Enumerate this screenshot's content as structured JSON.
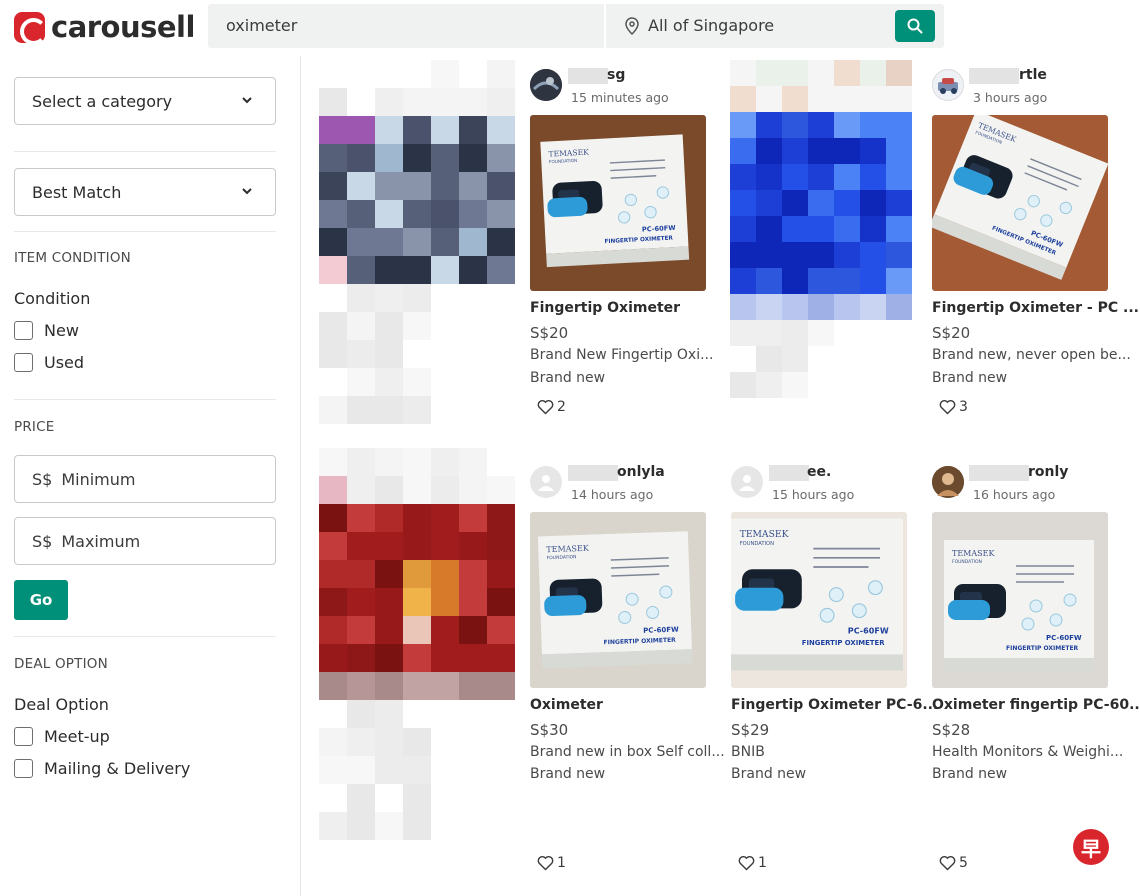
{
  "header": {
    "brand": "carousell",
    "search_query": "oximeter",
    "location": "All of Singapore"
  },
  "sidebar": {
    "category_select": "Select a category",
    "sort_select": "Best Match",
    "item_condition_header": "ITEM CONDITION",
    "condition_label": "Condition",
    "conditions": [
      "New",
      "Used"
    ],
    "price_header": "PRICE",
    "price_min": {
      "currency": "S$",
      "placeholder": "Minimum"
    },
    "price_max": {
      "currency": "S$",
      "placeholder": "Maximum"
    },
    "go_label": "Go",
    "deal_header": "DEAL OPTION",
    "deal_label": "Deal Option",
    "deals": [
      "Meet-up",
      "Mailing & Delivery"
    ]
  },
  "listings": [
    {
      "seller": "sg",
      "posted": "15 minutes ago",
      "title": "Fingertip Oximeter",
      "price": "S$20",
      "desc": "Brand New Fingertip Oxi...",
      "condition": "Brand new",
      "likes": "2"
    },
    {
      "seller": "rtle",
      "posted": "3 hours ago",
      "title": "Fingertip Oximeter - PC ...",
      "price": "S$20",
      "desc": "Brand new, never open be...",
      "condition": "Brand new",
      "likes": "3"
    },
    {
      "seller": "onlyla",
      "posted": "14 hours ago",
      "title": "Oximeter",
      "price": "S$30",
      "desc": "Brand new in box Self coll...",
      "condition": "Brand new",
      "likes": "1"
    },
    {
      "seller": "ee.",
      "posted": "15 hours ago",
      "title": "Fingertip Oximeter PC-6...",
      "price": "S$29",
      "desc": "BNIB",
      "condition": "Brand new",
      "likes": "1"
    },
    {
      "seller": "ronly",
      "posted": "16 hours ago",
      "title": "Oximeter fingertip PC-60...",
      "price": "S$28",
      "desc": "Health Monitors & Weighi...",
      "condition": "Brand new",
      "likes": "5"
    }
  ],
  "box_art": {
    "brand": "TEMASEK",
    "sub": "FOUNDATION",
    "model": "PC-60FW",
    "product": "FINGERTIP OXIMETER"
  },
  "watermark": "早",
  "colors": {
    "brand_red": "#d9262d",
    "accent_green": "#008f79"
  }
}
